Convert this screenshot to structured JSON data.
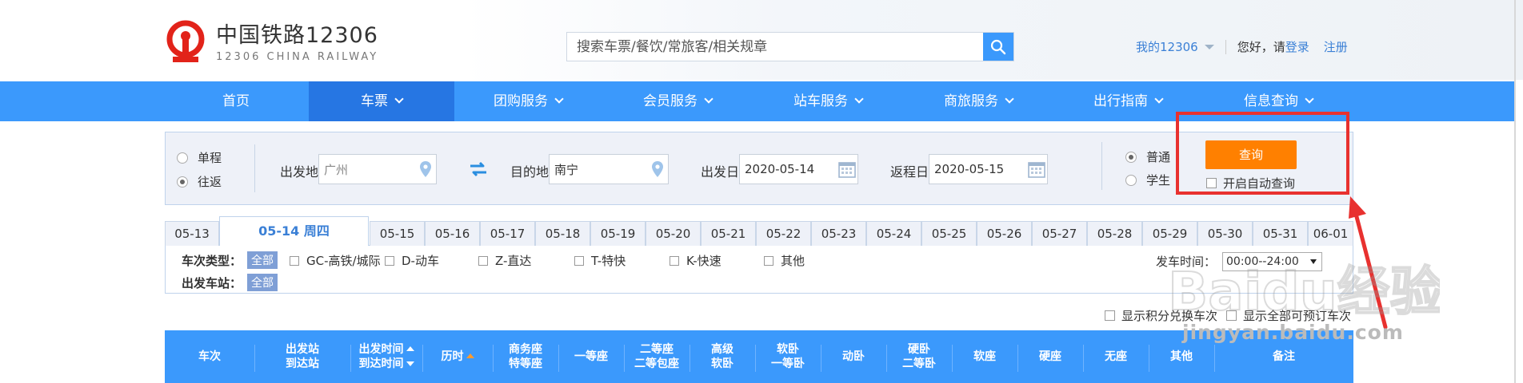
{
  "header": {
    "logo_cn": "中国铁路12306",
    "logo_en": "12306 CHINA RAILWAY",
    "search_placeholder": "搜索车票/餐饮/常旅客/相关规章",
    "my12306": "我的12306",
    "greeting": "您好，请",
    "login": "登录",
    "register": "注册"
  },
  "nav": [
    {
      "label": "首页",
      "dropdown": false,
      "active": false
    },
    {
      "label": "车票",
      "dropdown": true,
      "active": true
    },
    {
      "label": "团购服务",
      "dropdown": true,
      "active": false
    },
    {
      "label": "会员服务",
      "dropdown": true,
      "active": false
    },
    {
      "label": "站车服务",
      "dropdown": true,
      "active": false
    },
    {
      "label": "商旅服务",
      "dropdown": true,
      "active": false
    },
    {
      "label": "出行指南",
      "dropdown": true,
      "active": false
    },
    {
      "label": "信息查询",
      "dropdown": true,
      "active": false
    }
  ],
  "query": {
    "one_way": "单程",
    "round_trip": "往返",
    "selected_trip": "往返",
    "from_label": "出发地",
    "from_value": "广州",
    "to_label": "目的地",
    "to_value": "南宁",
    "depart_label": "出发日",
    "depart_value": "2020-05-14",
    "return_label": "返程日",
    "return_value": "2020-05-15",
    "normal": "普通",
    "student": "学生",
    "selected_passenger": "普通",
    "query_button": "查询",
    "auto_query": "开启自动查询"
  },
  "date_tabs": [
    "05-13",
    "05-14 周四",
    "05-15",
    "05-16",
    "05-17",
    "05-18",
    "05-19",
    "05-20",
    "05-21",
    "05-22",
    "05-23",
    "05-24",
    "05-25",
    "05-26",
    "05-27",
    "05-28",
    "05-29",
    "05-30",
    "05-31",
    "06-01"
  ],
  "active_date": "05-14 周四",
  "filters": {
    "train_type_label": "车次类型：",
    "all": "全部",
    "types": [
      "GC-高铁/城际",
      "D-动车",
      "Z-直达",
      "T-特快",
      "K-快速",
      "其他"
    ],
    "station_label": "出发车站：",
    "depart_time_label": "发车时间：",
    "depart_time_value": "00:00--24:00",
    "points_exchange": "显示积分兑换车次",
    "show_all_bookable": "显示全部可预订车次"
  },
  "table_headers": [
    {
      "l1": "车次",
      "l2": ""
    },
    {
      "l1": "出发站",
      "l2": "到达站"
    },
    {
      "l1": "出发时间",
      "l2": "到达时间"
    },
    {
      "l1": "历时",
      "l2": ""
    },
    {
      "l1": "商务座",
      "l2": "特等座"
    },
    {
      "l1": "一等座",
      "l2": ""
    },
    {
      "l1": "二等座",
      "l2": "二等包座"
    },
    {
      "l1": "高级",
      "l2": "软卧"
    },
    {
      "l1": "软卧",
      "l2": "一等卧"
    },
    {
      "l1": "动卧",
      "l2": ""
    },
    {
      "l1": "硬卧",
      "l2": "二等卧"
    },
    {
      "l1": "软座",
      "l2": ""
    },
    {
      "l1": "硬座",
      "l2": ""
    },
    {
      "l1": "无座",
      "l2": ""
    },
    {
      "l1": "其他",
      "l2": ""
    },
    {
      "l1": "备注",
      "l2": ""
    }
  ],
  "watermark": {
    "logo": "Baidu经验",
    "url": "jingyan.baidu.com"
  },
  "colors": {
    "nav_blue": "#3b99fc",
    "nav_active": "#2676e3",
    "query_orange": "#ff8000",
    "highlight_red": "#e8312f",
    "link_blue": "#3b80d6"
  }
}
